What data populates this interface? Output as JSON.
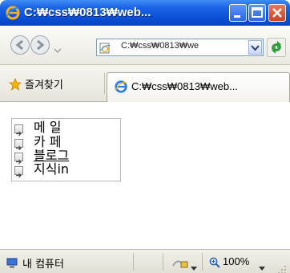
{
  "window": {
    "title": "C:₩css₩0813₩web...",
    "controls": {
      "minimize": "minimize",
      "maximize": "maximize",
      "close": "close"
    }
  },
  "nav": {
    "address": "C:₩css₩0813₩we",
    "icons": [
      "back-icon",
      "forward-icon",
      "chevron-down-icon",
      "page-icon",
      "refresh-icon"
    ]
  },
  "favorites": {
    "label": "즐겨찾기"
  },
  "tab": {
    "label": "C:₩css₩0813₩web..."
  },
  "menu": {
    "items": [
      {
        "label": "메 일"
      },
      {
        "label": "카 페"
      },
      {
        "label": "블로그"
      },
      {
        "label": "지식in"
      }
    ]
  },
  "status": {
    "zone": "내 컴퓨터",
    "zoom": "100%"
  },
  "colors": {
    "titlebar": "#0b4fd6",
    "close": "#c9412a",
    "menu_border": "#b9b9b9"
  }
}
